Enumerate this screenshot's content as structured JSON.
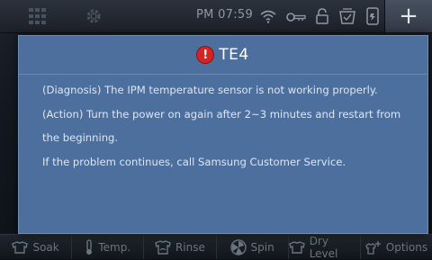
{
  "status_bar": {
    "time": "PM 07:59",
    "icons": [
      "grid-icon",
      "gear-icon",
      "wifi-icon",
      "key-icon",
      "lock-icon",
      "basket-icon",
      "phone-icon",
      "plus-icon"
    ],
    "plus_label": "+"
  },
  "dialog": {
    "icon_glyph": "!",
    "icon_color": "#d42424",
    "title": "TE4",
    "lines": [
      "(Diagnosis) The IPM temperature sensor is not working properly.",
      "(Action) Turn the power on again after 2~3 minutes and restart from",
      "the beginning.",
      "If the problem continues, call Samsung Customer Service."
    ]
  },
  "tabs": [
    {
      "label": "Soak",
      "icon": "soak-icon"
    },
    {
      "label": "Temp.",
      "icon": "thermometer-icon"
    },
    {
      "label": "Rinse",
      "icon": "rinse-icon"
    },
    {
      "label": "Spin",
      "icon": "spin-icon"
    },
    {
      "label": "Dry Level",
      "icon": "dry-level-icon"
    },
    {
      "label": "Options",
      "icon": "options-icon"
    }
  ]
}
